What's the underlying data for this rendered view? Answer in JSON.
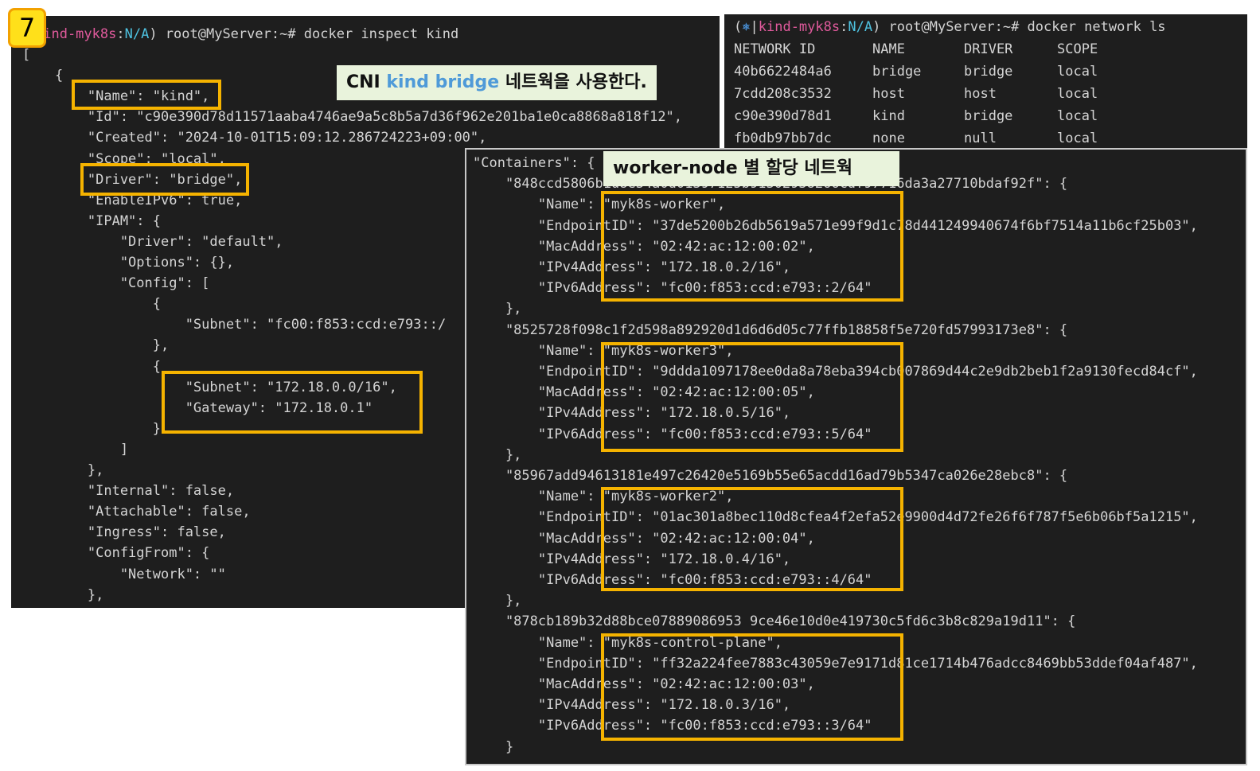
{
  "step_badge": "7",
  "annotations": {
    "cni_note_pre": "CNI ",
    "cni_note_accent": "kind bridge",
    "cni_note_post": " 네트웍을 사용한다.",
    "worker_note": "worker-node 별 할당 네트웍"
  },
  "colors": {
    "terminal_bg": "#1e1e1e",
    "terminal_text": "#d4d4d4",
    "prompt_context": "#e05a9c",
    "prompt_na": "#4ec2e0",
    "highlight_box": "#f5b300",
    "note_bg": "#e9f3dc",
    "badge_bg": "#ffe01a"
  },
  "inspect_terminal": {
    "prompt_context": "kind-myk8s",
    "prompt_sep": ":",
    "prompt_na": "N/A",
    "prompt_rest": ") root@MyServer:~# docker inspect kind",
    "lines": [
      "[",
      "    {",
      "        \"Name\": \"kind\",",
      "        \"Id\": \"c90e390d78d11571aaba4746ae9a5c8b5a7d36f962e201ba1e0ca8868a818f12\",",
      "        \"Created\": \"2024-10-01T15:09:12.286724223+09:00\",",
      "        \"Scope\": \"local\",",
      "        \"Driver\": \"bridge\",",
      "        \"EnableIPv6\": true,",
      "        \"IPAM\": {",
      "            \"Driver\": \"default\",",
      "            \"Options\": {},",
      "            \"Config\": [",
      "                {",
      "                    \"Subnet\": \"fc00:f853:ccd:e793::/",
      "                },",
      "                {",
      "                    \"Subnet\": \"172.18.0.0/16\",",
      "                    \"Gateway\": \"172.18.0.1\"",
      "                }",
      "            ]",
      "        },",
      "        \"Internal\": false,",
      "        \"Attachable\": false,",
      "        \"Ingress\": false,",
      "        \"ConfigFrom\": {",
      "            \"Network\": \"\"",
      "        },"
    ]
  },
  "network_ls_terminal": {
    "prompt_open": "(",
    "prompt_icon": "⎈",
    "prompt_bar": "|",
    "prompt_context": "kind-myk8s",
    "prompt_sep": ":",
    "prompt_na": "N/A",
    "prompt_rest": ") root@MyServer:~# docker network ls",
    "columns": [
      "NETWORK ID",
      "NAME",
      "DRIVER",
      "SCOPE"
    ],
    "rows": [
      [
        "40b6622484a6",
        "bridge",
        "bridge",
        "local"
      ],
      [
        "7cdd208c3532",
        "host",
        "host",
        "local"
      ],
      [
        "c90e390d78d1",
        "kind",
        "bridge",
        "local"
      ],
      [
        "fb0db97bb7dc",
        "none",
        "null",
        "local"
      ]
    ]
  },
  "containers_terminal": {
    "lines": [
      "\"Containers\": {",
      "    \"848ccd5806b1d8e34a0d01397125b91302938266cdf97716da3a27710bdaf92f\": {",
      "        \"Name\": \"myk8s-worker\",",
      "        \"EndpointID\": \"37de5200b26db5619a571e99f9d1c78d441249940674f6bf7514a11b6cf25b03\",",
      "        \"MacAddress\": \"02:42:ac:12:00:02\",",
      "        \"IPv4Address\": \"172.18.0.2/16\",",
      "        \"IPv6Address\": \"fc00:f853:ccd:e793::2/64\"",
      "    },",
      "    \"8525728f098c1f2d598a892920d1d6d6d05c77ffb18858f5e720fd57993173e8\": {",
      "        \"Name\": \"myk8s-worker3\",",
      "        \"EndpointID\": \"9ddda1097178ee0da8a78eba394cb007869d44c2e9db2beb1f2a9130fecd84cf\",",
      "        \"MacAddress\": \"02:42:ac:12:00:05\",",
      "        \"IPv4Address\": \"172.18.0.5/16\",",
      "        \"IPv6Address\": \"fc00:f853:ccd:e793::5/64\"",
      "    },",
      "    \"85967add94613181e497c26420e5169b55e65acdd16ad79b5347ca026e28ebc8\": {",
      "        \"Name\": \"myk8s-worker2\",",
      "        \"EndpointID\": \"01ac301a8bec110d8cfea4f2efa52e9900d4d72fe26f6f787f5e6b06bf5a1215\",",
      "        \"MacAddress\": \"02:42:ac:12:00:04\",",
      "        \"IPv4Address\": \"172.18.0.4/16\",",
      "        \"IPv6Address\": \"fc00:f853:ccd:e793::4/64\"",
      "    },",
      "    \"878cb189b32d88bce07889086953 9ce46e10d0e419730c5fd6c3b8c829a19d11\": {",
      "        \"Name\": \"myk8s-control-plane\",",
      "        \"EndpointID\": \"ff32a224fee7883c43059e7e9171d81ce1714b476adcc8469bb53ddef04af487\",",
      "        \"MacAddress\": \"02:42:ac:12:00:03\",",
      "        \"IPv4Address\": \"172.18.0.3/16\",",
      "        \"IPv6Address\": \"fc00:f853:ccd:e793::3/64\"",
      "    }"
    ]
  }
}
